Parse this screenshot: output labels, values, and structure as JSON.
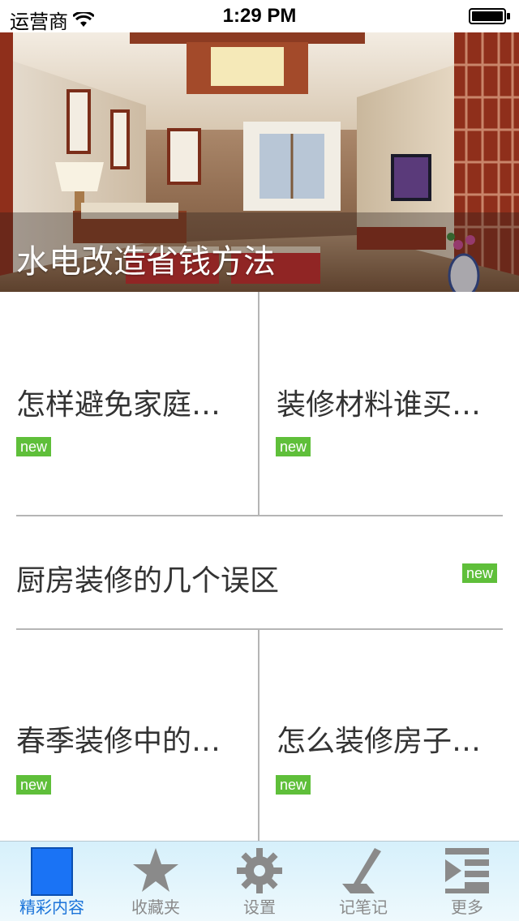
{
  "status_bar": {
    "carrier": "运营商",
    "time": "1:29 PM"
  },
  "hero": {
    "title": "水电改造省钱方法"
  },
  "articles": [
    {
      "title": "怎样避免家庭…",
      "badge": "new"
    },
    {
      "title": "装修材料谁买…",
      "badge": "new"
    },
    {
      "title": "厨房装修的几个误区",
      "badge": "new"
    },
    {
      "title": "春季装修中的…",
      "badge": "new"
    },
    {
      "title": "怎么装修房子…",
      "badge": "new"
    }
  ],
  "tabs": [
    {
      "label": "精彩内容",
      "icon": "page-icon",
      "active": true
    },
    {
      "label": "收藏夹",
      "icon": "star-icon",
      "active": false
    },
    {
      "label": "设置",
      "icon": "gear-icon",
      "active": false
    },
    {
      "label": "记笔记",
      "icon": "pen-icon",
      "active": false
    },
    {
      "label": "更多",
      "icon": "list-icon",
      "active": false
    }
  ],
  "colors": {
    "badge": "#5fbf3a",
    "active_tab": "#1a73d9",
    "inactive_tab": "#8a8a8a",
    "tab_bar_bg": "#d6f0fb"
  }
}
